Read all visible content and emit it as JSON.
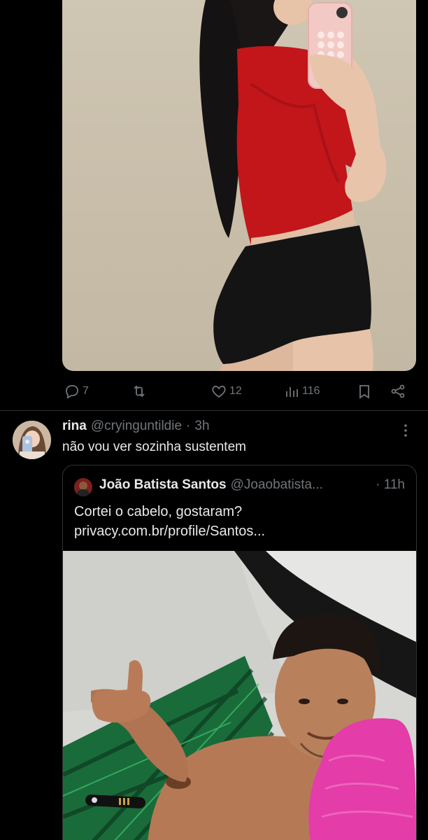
{
  "actions": {
    "replies": "7",
    "retweets": "",
    "likes": "12",
    "views": "116"
  },
  "reply": {
    "name": "rina",
    "handle": "@cryinguntildie",
    "dot": "·",
    "time": "3h",
    "text": "não vou ver sozinha sustentem"
  },
  "quote": {
    "name": "João Batista Santos",
    "handle": "@Joaobatista...",
    "time": "· 11h",
    "text_line1": "Cortei o cabelo, gostaram?",
    "text_line2": "privacy.com.br/profile/Santos..."
  },
  "icons": {
    "reply": "reply-icon",
    "retweet": "retweet-icon",
    "like": "heart-icon",
    "views": "views-icon",
    "bookmark": "bookmark-icon",
    "share": "share-icon",
    "more": "more-icon"
  }
}
